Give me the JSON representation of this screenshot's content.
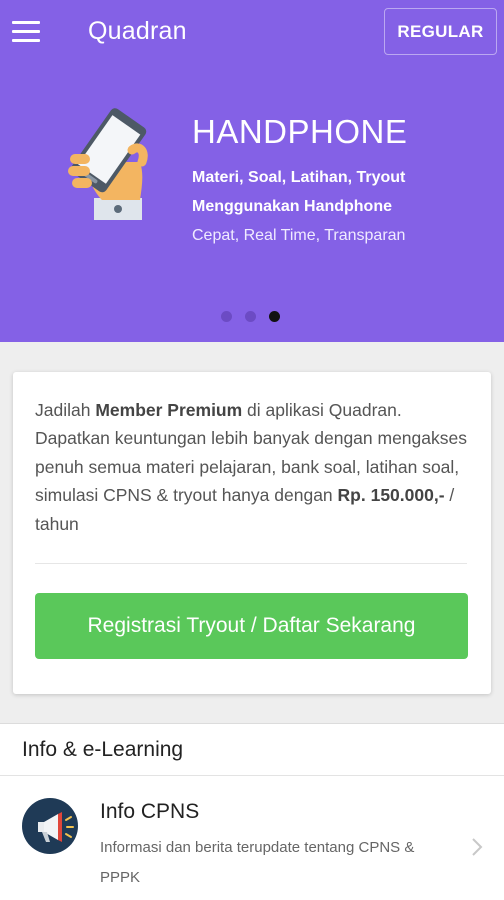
{
  "header": {
    "app_title": "Quadran",
    "menu_icon": "hamburger-menu-icon",
    "action_label": "REGULAR"
  },
  "slider": {
    "title": "HANDPHONE",
    "line1": "Materi, Soal, Latihan, Tryout",
    "line2": "Menggunakan Handphone",
    "line3": "Cepat, Real Time, Transparan",
    "illustration_icon": "hand-holding-phone-icon",
    "total_slides": 3,
    "active_slide": 3
  },
  "premium": {
    "t1": "Jadilah ",
    "t2": "Member Premium",
    "t3": " di aplikasi Quadran. Dapatkan keuntungan lebih banyak dengan mengakses penuh semua materi pelajaran, bank soal, latihan soal, simulasi CPNS & tryout hanya dengan ",
    "t4": "Rp. 150.000,-",
    "t5": " / tahun",
    "button_label": "Registrasi Tryout / Daftar Sekarang"
  },
  "section": {
    "title": "Info & e-Learning"
  },
  "list": {
    "items": [
      {
        "title": "Info CPNS",
        "desc": "Informasi dan berita terupdate tentang CPNS & PPPK",
        "icon": "megaphone-icon",
        "chevron": "chevron-right-icon"
      }
    ]
  },
  "colors": {
    "primary": "#8461e6",
    "accent_green": "#5ac85a",
    "dot_inactive": "#6c4bc4",
    "dot_active": "#111111",
    "icon_bg": "#1f3a56"
  }
}
